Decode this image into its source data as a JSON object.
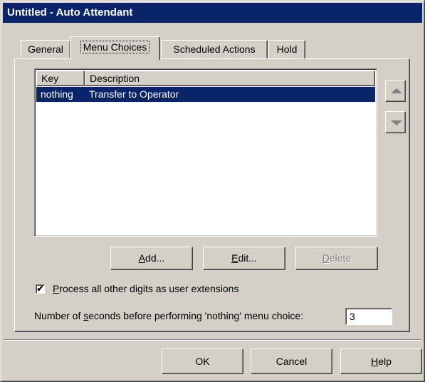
{
  "window": {
    "title": "Untitled - Auto Attendant"
  },
  "tabs": [
    {
      "label": "General"
    },
    {
      "label": "Menu Choices"
    },
    {
      "label": "Scheduled Actions"
    },
    {
      "label": "Hold"
    }
  ],
  "menu_choices": {
    "columns": [
      "Key",
      "Description"
    ],
    "rows": [
      {
        "key": "nothing",
        "description": "Transfer to Operator"
      }
    ],
    "buttons": {
      "add": {
        "u": "A",
        "rest": "dd..."
      },
      "edit": {
        "u": "E",
        "rest": "dit..."
      },
      "delete": {
        "u": "D",
        "rest": "elete"
      }
    },
    "process_checkbox": {
      "checked_mark": "✔",
      "u": "P",
      "rest": "rocess all other digits as user extensions"
    },
    "seconds_label": {
      "pre": "Number of ",
      "u": "s",
      "post": "econds before performing 'nothing' menu choice:"
    },
    "seconds_value": "3"
  },
  "footer": {
    "ok": "OK",
    "cancel": "Cancel",
    "help": {
      "u": "H",
      "rest": "elp"
    }
  },
  "icons": {
    "move_up": "triangle-up-icon",
    "move_down": "triangle-down-icon"
  },
  "colors": {
    "titlebar": "#0a246a",
    "selection": "#0a246a",
    "face": "#d4d0c8"
  }
}
